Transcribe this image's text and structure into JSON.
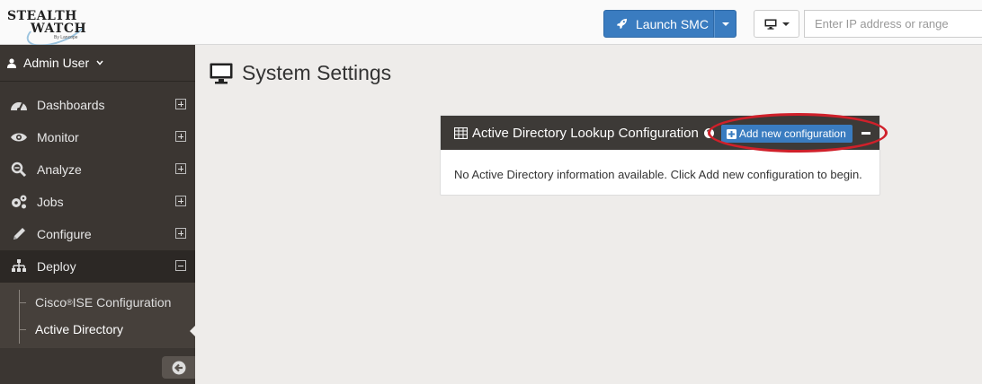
{
  "header": {
    "logo_line1": "STEALTH",
    "logo_line2": "WATCH",
    "logo_tagline": "By Lancope",
    "launch_label": "Launch SMC",
    "ip_placeholder": "Enter IP address or range"
  },
  "sidebar": {
    "user_label": "Admin User",
    "items": [
      {
        "label": "Dashboards",
        "icon": "dashboard-icon"
      },
      {
        "label": "Monitor",
        "icon": "eye-icon"
      },
      {
        "label": "Analyze",
        "icon": "magnifier-icon"
      },
      {
        "label": "Jobs",
        "icon": "gears-icon"
      },
      {
        "label": "Configure",
        "icon": "pencil-icon"
      },
      {
        "label": "Deploy",
        "icon": "sitemap-icon"
      }
    ],
    "subitems": [
      {
        "label_pre": "Cisco",
        "label_sup": "®",
        "label_post": " ISE Configuration"
      },
      {
        "label": "Active Directory"
      }
    ]
  },
  "main": {
    "page_title": "System Settings",
    "panel": {
      "title": "Active Directory Lookup Configuration",
      "help": "?",
      "add_label": "Add new configuration",
      "empty_message": "No Active Directory information available. Click Add new configuration to begin."
    }
  },
  "colors": {
    "primary_blue": "#3a7cc0",
    "sidebar_bg": "#3b3632",
    "panel_header": "#3d3a37",
    "highlight_red": "#d0202a"
  }
}
